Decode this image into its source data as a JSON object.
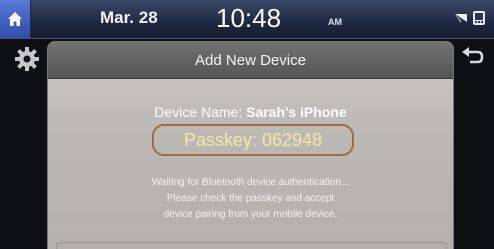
{
  "status_bar": {
    "date": "Mar. 28",
    "time": "10:48",
    "ampm": "AM",
    "icons": [
      "home-icon",
      "signal-icon",
      "bluetooth-phone-icon"
    ]
  },
  "side": {
    "icons": [
      "gear-icon",
      "back-arrow-icon"
    ]
  },
  "dialog": {
    "title": "Add New Device",
    "device_name_label": "Device Name:",
    "device_name_value": "Sarah's iPhone",
    "passkey": "Passkey: 062948",
    "message_lines": [
      "Waiting for Bluetooth device authentication...",
      "Please check the passkey and accept",
      "device pairing from your mobile device."
    ]
  },
  "colors": {
    "accent_home": "#3d5fc6",
    "passkey_border": "#a06a4a",
    "passkey_text": "#f6e6a2"
  }
}
